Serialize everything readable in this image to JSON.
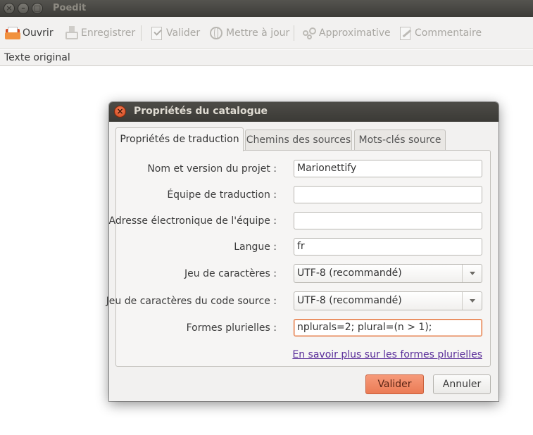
{
  "window": {
    "title": "Poedit",
    "close_glyph": "×",
    "minimize_glyph": "–",
    "maximize_glyph": "□"
  },
  "toolbar": {
    "items": [
      {
        "label": "Ouvrir",
        "icon": "open-folder-icon",
        "enabled": true
      },
      {
        "label": "Enregistrer",
        "icon": "save-icon",
        "enabled": false
      },
      {
        "label": "Valider",
        "icon": "validate-icon",
        "enabled": false
      },
      {
        "label": "Mettre à jour",
        "icon": "update-globe-icon",
        "enabled": false
      },
      {
        "label": "Approximative",
        "icon": "fuzzy-icon",
        "enabled": false
      },
      {
        "label": "Commentaire",
        "icon": "comment-icon",
        "enabled": false
      }
    ]
  },
  "list": {
    "column_header": "Texte original"
  },
  "dialog": {
    "title": "Propriétés du catalogue",
    "close_glyph": "×",
    "tabs": [
      {
        "label": "Propriétés de traduction",
        "active": true
      },
      {
        "label": "Chemins des sources",
        "active": false
      },
      {
        "label": "Mots-clés source",
        "active": false
      }
    ],
    "fields": {
      "project": {
        "label": "Nom et version du projet :",
        "value": "Marionettify"
      },
      "team": {
        "label": "Équipe de traduction :",
        "value": ""
      },
      "team_email": {
        "label": "Adresse électronique de l'équipe :",
        "value": ""
      },
      "language": {
        "label": "Langue :",
        "value": "fr"
      },
      "charset": {
        "label": "Jeu de caractères :",
        "value": "UTF-8 (recommandé)"
      },
      "source_charset": {
        "label": "Jeu de caractères du code source :",
        "value": "UTF-8 (recommandé)"
      },
      "plural_forms": {
        "label": "Formes plurielles :",
        "value": "nplurals=2; plural=(n > 1);"
      }
    },
    "plural_link": "En savoir plus sur les formes plurielles",
    "buttons": {
      "ok": "Valider",
      "cancel": "Annuler"
    },
    "accent_color": "#eb7b55"
  }
}
